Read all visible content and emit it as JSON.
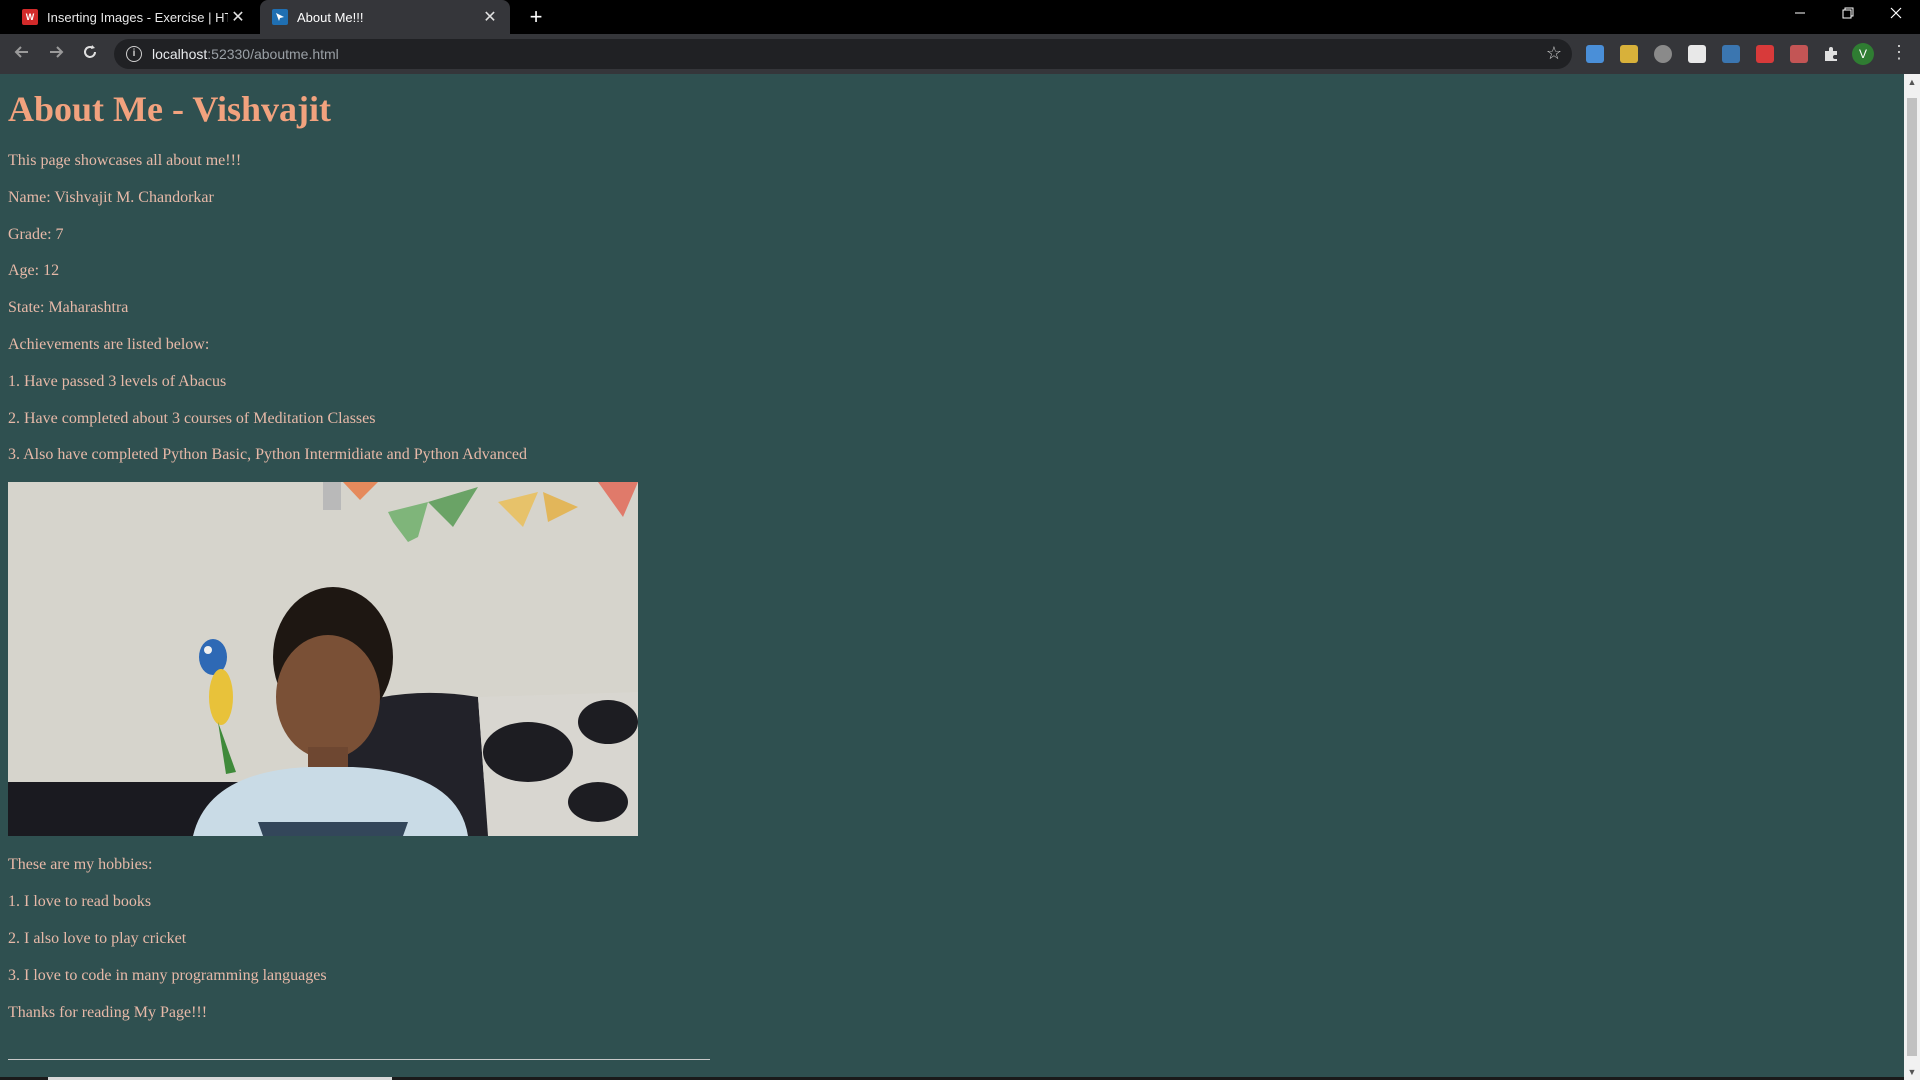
{
  "browser": {
    "tabs": [
      {
        "title": "Inserting Images - Exercise | HTML",
        "icon": "ws-favicon-icon",
        "active": false
      },
      {
        "title": "About Me!!!",
        "icon": "page-favicon-icon",
        "active": true
      }
    ],
    "new_tab_glyph": "+",
    "close_glyph": "✕",
    "url_host": "localhost",
    "url_rest": ":52330/aboutme.html",
    "profile_initial": "V"
  },
  "page": {
    "heading": "About Me - Vishvajit",
    "intro": "This page showcases all about me!!!",
    "name": "Name: Vishvajit M. Chandorkar",
    "grade": "Grade: 7",
    "age": "Age: 12",
    "state": "State: Maharashtra",
    "achievements_intro": "Achievements are listed below:",
    "achievements": [
      "1. Have passed 3 levels of Abacus",
      "2. Have completed about 3 courses of Meditation Classes",
      "3. Also have completed Python Basic, Python Intermidiate and Python Advanced"
    ],
    "hobbies_intro": "These are my hobbies:",
    "hobbies": [
      "1. I love to read books",
      "2. I also love to play cricket",
      "3. I love to code in many programming languages"
    ],
    "thanks": "Thanks for reading My Page!!!"
  },
  "colors": {
    "page_background": "#2f5050",
    "heading": "#f2a27e",
    "body_text": "#e7b9a8"
  }
}
